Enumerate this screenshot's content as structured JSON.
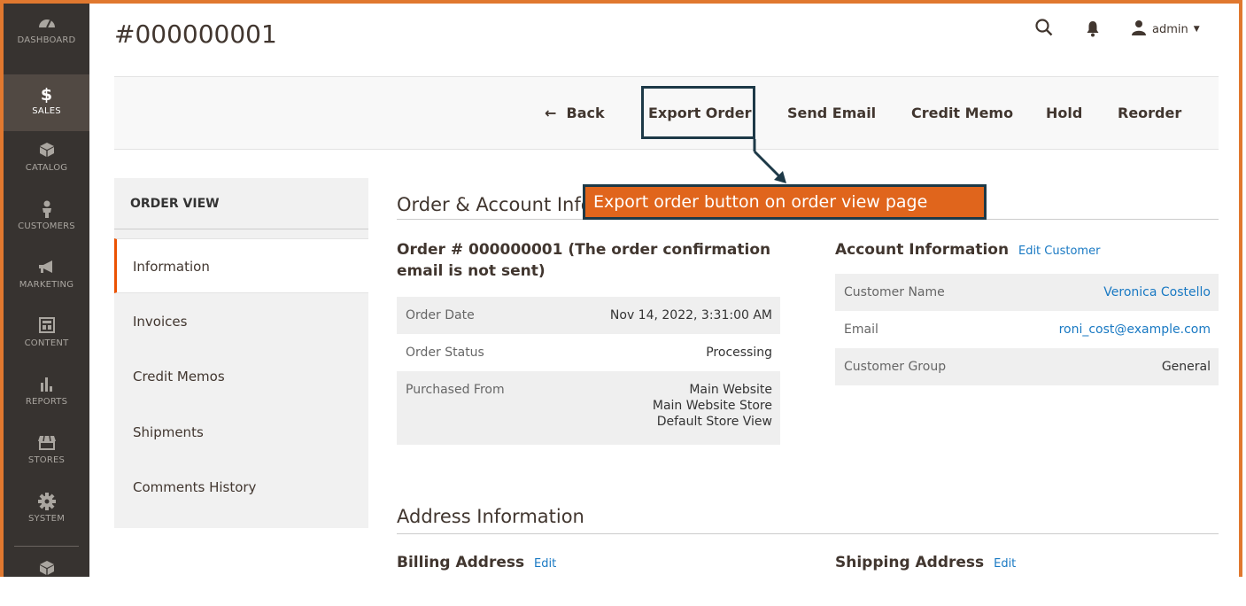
{
  "sidebar": {
    "items": [
      {
        "label": "DASHBOARD",
        "icon": "dashboard-icon"
      },
      {
        "label": "SALES",
        "icon": "dollar-icon"
      },
      {
        "label": "CATALOG",
        "icon": "catalog-box-icon"
      },
      {
        "label": "CUSTOMERS",
        "icon": "customer-person-icon"
      },
      {
        "label": "MARKETING",
        "icon": "megaphone-icon"
      },
      {
        "label": "CONTENT",
        "icon": "content-layout-icon"
      },
      {
        "label": "REPORTS",
        "icon": "bar-chart-icon"
      },
      {
        "label": "STORES",
        "icon": "store-icon"
      },
      {
        "label": "SYSTEM",
        "icon": "gear-icon"
      }
    ],
    "sales_symbol": "$"
  },
  "header": {
    "title": "#000000001",
    "user": "admin"
  },
  "actions": {
    "back": "Back",
    "back_arrow": "←",
    "export": "Export Order",
    "send_email": "Send Email",
    "credit_memo": "Credit Memo",
    "hold": "Hold",
    "reorder": "Reorder"
  },
  "callout": "Export order button on order view page",
  "order_view": {
    "title": "ORDER VIEW",
    "tabs": [
      "Information",
      "Invoices",
      "Credit Memos",
      "Shipments",
      "Comments History"
    ]
  },
  "order_account": {
    "section_title": "Order & Account Infor",
    "order_heading": "Order # 000000001 (The order confirmation email is not sent)",
    "order_heading_line1": "Order # 000000001 (The order confirmation",
    "order_heading_line2": "email is not sent)",
    "order_rows": [
      {
        "label": "Order Date",
        "value": "Nov 14, 2022, 3:31:00 AM"
      },
      {
        "label": "Order Status",
        "value": "Processing"
      },
      {
        "label": "Purchased From",
        "value_lines": [
          "Main Website",
          "Main Website Store",
          "Default Store View"
        ]
      }
    ],
    "account_heading": "Account Information",
    "account_edit": "Edit Customer",
    "account_rows": [
      {
        "label": "Customer Name",
        "value": "Veronica Costello"
      },
      {
        "label": "Email",
        "value": "roni_cost@example.com"
      },
      {
        "label": "Customer Group",
        "value": "General"
      }
    ]
  },
  "address": {
    "section_title": "Address Information",
    "billing": "Billing Address",
    "billing_edit": "Edit",
    "shipping": "Shipping Address",
    "shipping_edit": "Edit"
  },
  "colors": {
    "frame": "#e0782f",
    "sidebar": "#373330",
    "callout_bg": "#e0651c",
    "highlight_border": "#1d3947",
    "link": "#1979c3",
    "tab_accent": "#eb5202"
  }
}
